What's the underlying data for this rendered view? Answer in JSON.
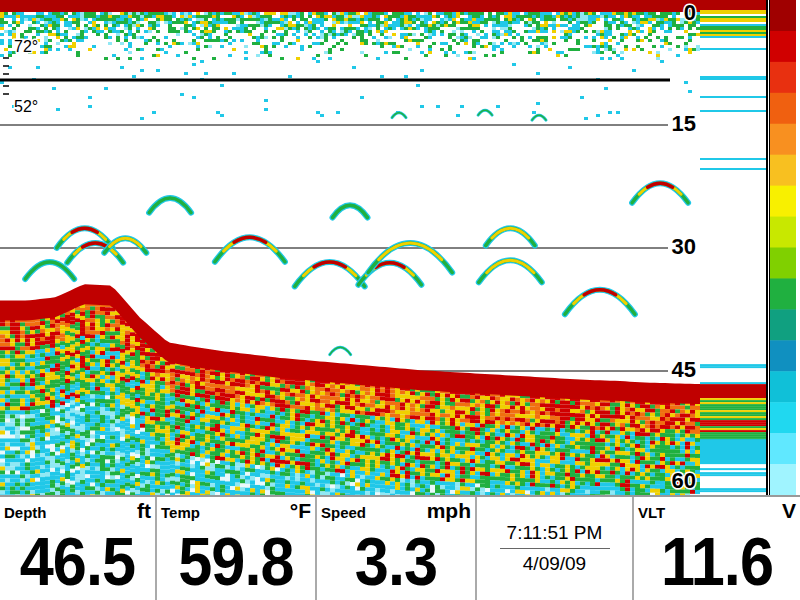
{
  "sonar": {
    "depth_scale": [
      "0",
      "15",
      "30",
      "45",
      "60"
    ],
    "temp_graph": {
      "labels": [
        "72°",
        "52°"
      ],
      "values_f": [
        61.3,
        61.3,
        61.3,
        61.3,
        61.3,
        61.3,
        61.3,
        61.3,
        61.3,
        61.3,
        61.3,
        61.3,
        61.3,
        61.3,
        61.3,
        61.3,
        61.3,
        61.3,
        61.3,
        61.3
      ]
    },
    "fish": [
      {
        "ping": 12.1,
        "ft": 27.6,
        "span": 8,
        "strength": 0.9
      },
      {
        "ping": 13.6,
        "ft": 29.4,
        "span": 8,
        "strength": 0.8
      },
      {
        "ping": 7.1,
        "ft": 31.7,
        "span": 7,
        "strength": 0.3
      },
      {
        "ping": 17.9,
        "ft": 28.8,
        "span": 6,
        "strength": 0.4
      },
      {
        "ping": 24.3,
        "ft": 23.9,
        "span": 6,
        "strength": 0.3
      },
      {
        "ping": 35.7,
        "ft": 28.7,
        "span": 10,
        "strength": 0.9
      },
      {
        "ping": 47.1,
        "ft": 31.7,
        "span": 10,
        "strength": 0.9
      },
      {
        "ping": 55.7,
        "ft": 31.8,
        "span": 9,
        "strength": 0.8
      },
      {
        "ping": 58.6,
        "ft": 29.4,
        "span": 12,
        "strength": 0.5
      },
      {
        "ping": 50.0,
        "ft": 24.8,
        "span": 5,
        "strength": 0.3
      },
      {
        "ping": 72.9,
        "ft": 27.6,
        "span": 7,
        "strength": 0.4
      },
      {
        "ping": 72.9,
        "ft": 31.5,
        "span": 9,
        "strength": 0.5
      },
      {
        "ping": 85.7,
        "ft": 35.1,
        "span": 10,
        "strength": 0.8
      },
      {
        "ping": 94.3,
        "ft": 22.1,
        "span": 8,
        "strength": 0.9
      },
      {
        "ping": 48.6,
        "ft": 42.1,
        "span": 3,
        "strength": 0.2
      },
      {
        "ping": 57.0,
        "ft": 13.5,
        "span": 2,
        "strength": 0.2
      },
      {
        "ping": 69.3,
        "ft": 13.2,
        "span": 2,
        "strength": 0.1
      },
      {
        "ping": 77.0,
        "ft": 13.8,
        "span": 2,
        "strength": 0.1
      }
    ],
    "bottom_ft": [
      36.4,
      36.4,
      36.0,
      34.4,
      34.6,
      38.5,
      41.5,
      42.1,
      42.6,
      43.0,
      43.4,
      43.7,
      44.0,
      44.3,
      44.6,
      44.9,
      45.1,
      45.3,
      45.5,
      45.7,
      45.9,
      46.1,
      46.2,
      46.4,
      46.5,
      46.6
    ]
  },
  "readouts": [
    {
      "kind": "gauge",
      "label": "Depth",
      "unit": "ft",
      "value": "46.5"
    },
    {
      "kind": "gauge",
      "label": "Temp",
      "unit": "°F",
      "value": "59.8"
    },
    {
      "kind": "gauge",
      "label": "Speed",
      "unit": "mph",
      "value": "3.3"
    },
    {
      "kind": "clock",
      "time": "7:11:51 PM",
      "date": "4/09/09"
    },
    {
      "kind": "gauge",
      "label": "VLT",
      "unit": "V",
      "value": "11.6"
    }
  ]
}
